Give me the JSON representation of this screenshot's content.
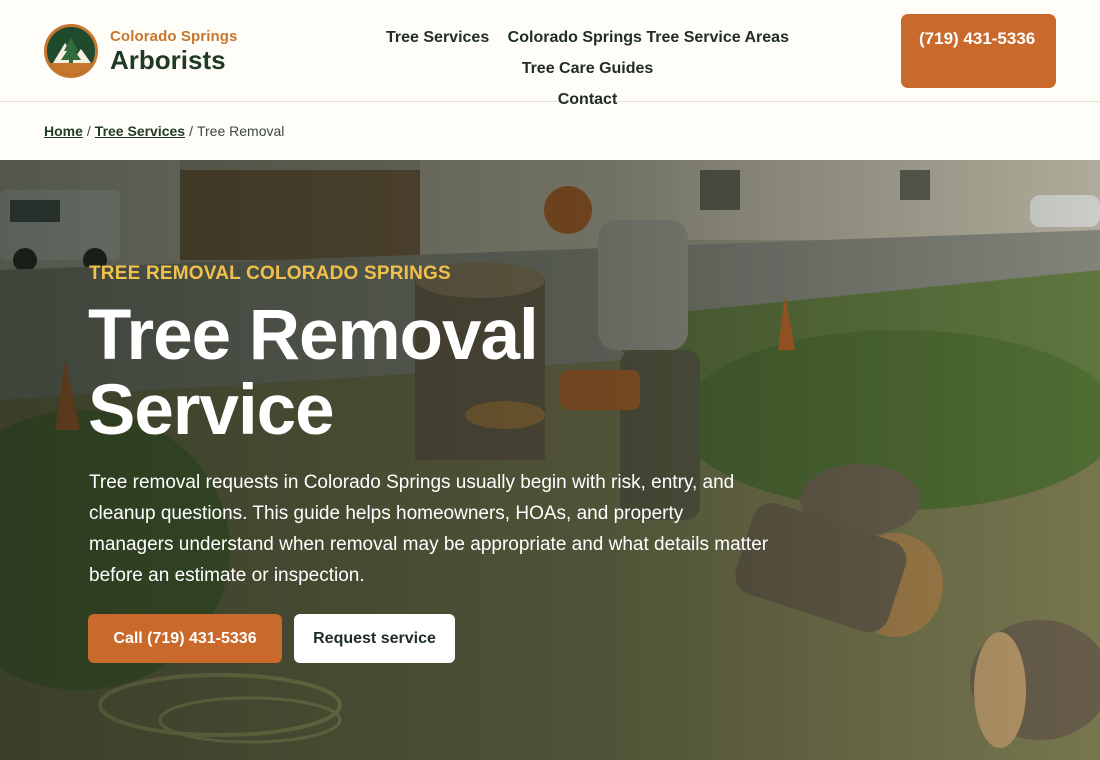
{
  "brand": {
    "name_top": "Colorado Springs",
    "name_bottom": "Arborists",
    "logo_icon": "tree-mountain-logo-icon"
  },
  "nav": {
    "items": [
      {
        "label": "Tree Services"
      },
      {
        "label": "Colorado Springs Tree Service Areas"
      },
      {
        "label": "Tree Care Guides"
      },
      {
        "label": "Contact"
      }
    ]
  },
  "header": {
    "phone_label": "(719) 431-5336"
  },
  "breadcrumb": {
    "home": "Home",
    "separator": "/",
    "services": "Tree Services",
    "current": "Tree Removal"
  },
  "hero": {
    "eyebrow": "TREE REMOVAL COLORADO SPRINGS",
    "title": "Tree Removal Service",
    "description": "Tree removal requests in Colorado Springs usually begin with risk, entry, and cleanup questions. This guide helps homeowners, HOAs, and property managers understand when removal may be appropriate and what details matter before an estimate or inspection.",
    "call_button": "Call (719) 431-5336",
    "request_button": "Request service"
  },
  "colors": {
    "accent": "#c9692b",
    "brand_green": "#1f4a2c",
    "eyebrow": "#f0c04b",
    "background": "#fffdf7"
  }
}
